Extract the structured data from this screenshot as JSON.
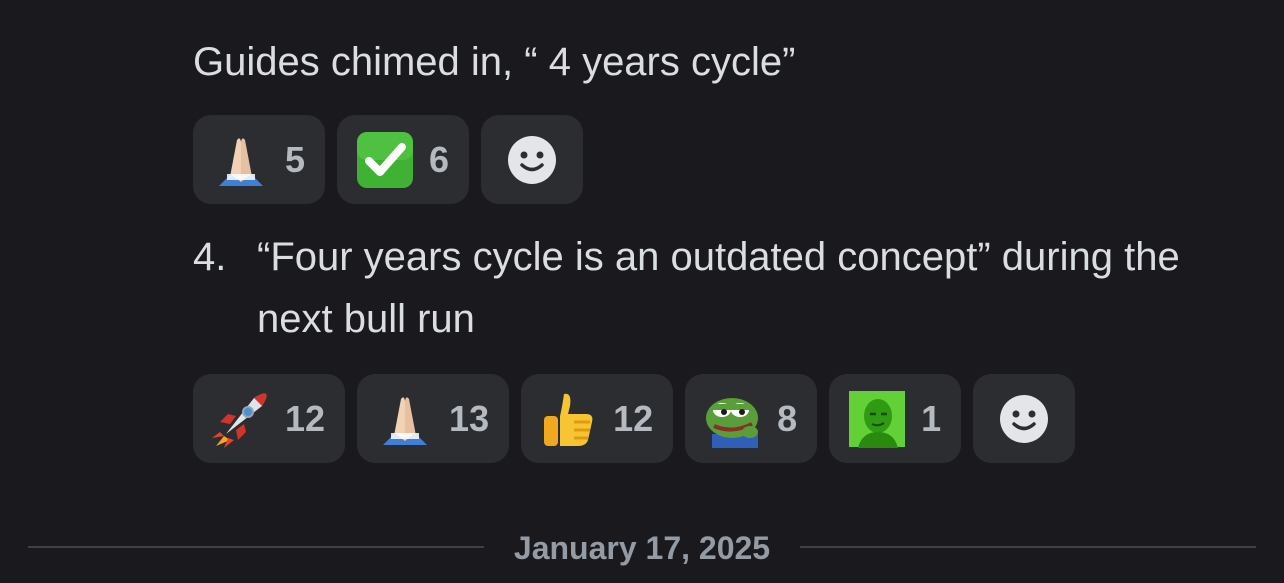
{
  "message": {
    "line1": "Guides chimed in, “ 4 years cycle”",
    "list_item": {
      "number": "4.",
      "text": "“Four years cycle is an outdated concept” during the next bull run"
    }
  },
  "reactions_row1": [
    {
      "emoji": "folded-hands-icon",
      "count": "5"
    },
    {
      "emoji": "check-mark-button-icon",
      "count": "6"
    }
  ],
  "reactions_row2": [
    {
      "emoji": "rocket-icon",
      "count": "12"
    },
    {
      "emoji": "folded-hands-icon",
      "count": "13"
    },
    {
      "emoji": "thumbs-up-icon",
      "count": "12"
    },
    {
      "emoji": "pepe-frog-icon",
      "count": "8"
    },
    {
      "emoji": "green-face-icon",
      "count": "1"
    }
  ],
  "date_divider": "January 17, 2025",
  "colors": {
    "background": "#1a1a1e",
    "reaction_bg": "#2b2d31",
    "text": "#dbdee1",
    "muted": "#949ba4"
  }
}
